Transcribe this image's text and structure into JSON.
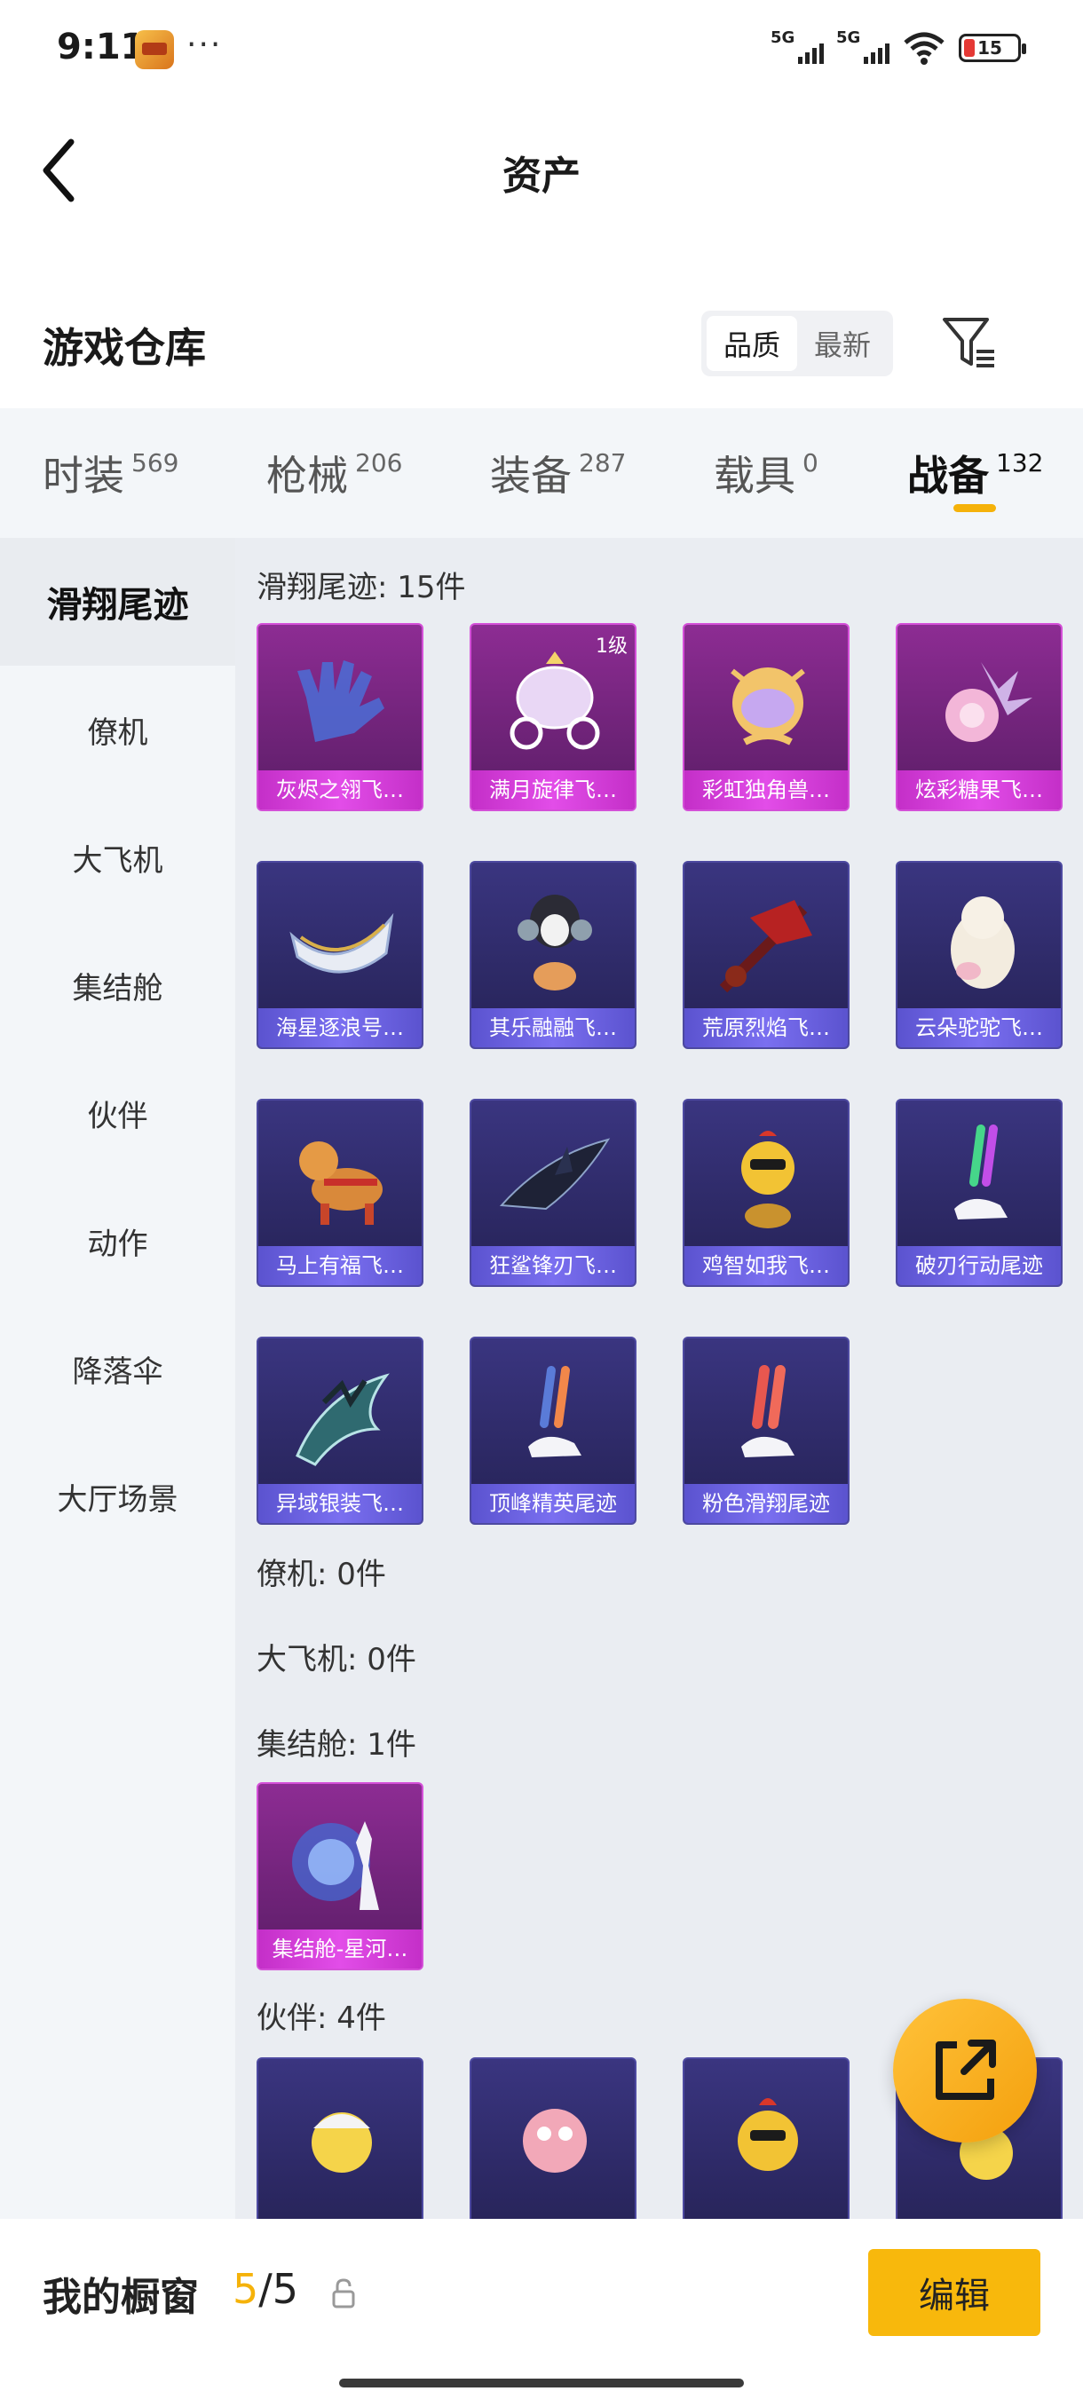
{
  "status_bar": {
    "time": "9:11",
    "dots": "···",
    "signal1": "5G",
    "signal2": "5G",
    "battery": "15"
  },
  "header": {
    "title": "资产",
    "back_icon": "back-arrow-icon"
  },
  "warehouse": {
    "title": "游戏仓库",
    "sort_options": [
      "品质",
      "最新"
    ],
    "active_sort": "品质",
    "filter_icon": "filter-icon"
  },
  "tabs": [
    {
      "label": "时装",
      "count": "569"
    },
    {
      "label": "枪械",
      "count": "206"
    },
    {
      "label": "装备",
      "count": "287"
    },
    {
      "label": "载具",
      "count": "0"
    },
    {
      "label": "战备",
      "count": "132"
    }
  ],
  "active_tab": "战备",
  "accent_color": "#f5b20a",
  "sidebar": [
    {
      "label": "滑翔尾迹",
      "active": true
    },
    {
      "label": "僚机",
      "active": false
    },
    {
      "label": "大飞机",
      "active": false
    },
    {
      "label": "集结舱",
      "active": false
    },
    {
      "label": "伙伴",
      "active": false
    },
    {
      "label": "动作",
      "active": false
    },
    {
      "label": "降落伞",
      "active": false
    },
    {
      "label": "大厅场景",
      "active": false
    }
  ],
  "sections": {
    "glide": {
      "title": "滑翔尾迹: 15件",
      "items": [
        {
          "label": "灰烬之翎飞…",
          "rarity": "pink"
        },
        {
          "label": "满月旋律飞…",
          "rarity": "pink",
          "level": "1级"
        },
        {
          "label": "彩虹独角兽…",
          "rarity": "pink"
        },
        {
          "label": "炫彩糖果飞…",
          "rarity": "pink"
        },
        {
          "label": "海星逐浪号…",
          "rarity": "purple"
        },
        {
          "label": "其乐融融飞…",
          "rarity": "purple"
        },
        {
          "label": "荒原烈焰飞…",
          "rarity": "purple"
        },
        {
          "label": "云朵驼驼飞…",
          "rarity": "purple"
        },
        {
          "label": "马上有福飞…",
          "rarity": "purple"
        },
        {
          "label": "狂鲨锋刃飞…",
          "rarity": "purple"
        },
        {
          "label": "鸡智如我飞…",
          "rarity": "purple"
        },
        {
          "label": "破刃行动尾迹",
          "rarity": "purple"
        },
        {
          "label": "异域银装飞…",
          "rarity": "purple"
        },
        {
          "label": "顶峰精英尾迹",
          "rarity": "purple"
        },
        {
          "label": "粉色滑翔尾迹",
          "rarity": "purple"
        }
      ]
    },
    "wingman": {
      "title": "僚机: 0件"
    },
    "big_plane": {
      "title": "大飞机: 0件"
    },
    "pod": {
      "title": "集结舱: 1件",
      "items": [
        {
          "label": "集结舱-星河…",
          "rarity": "pink"
        }
      ]
    },
    "partner": {
      "title": "伙伴: 4件"
    }
  },
  "fab_icon": "share-export-icon",
  "bottom": {
    "showcase_label": "我的橱窗",
    "showcase_current": "5",
    "showcase_sep": "/",
    "showcase_total": "5",
    "lock_icon": "lock-icon",
    "edit_label": "编辑"
  }
}
